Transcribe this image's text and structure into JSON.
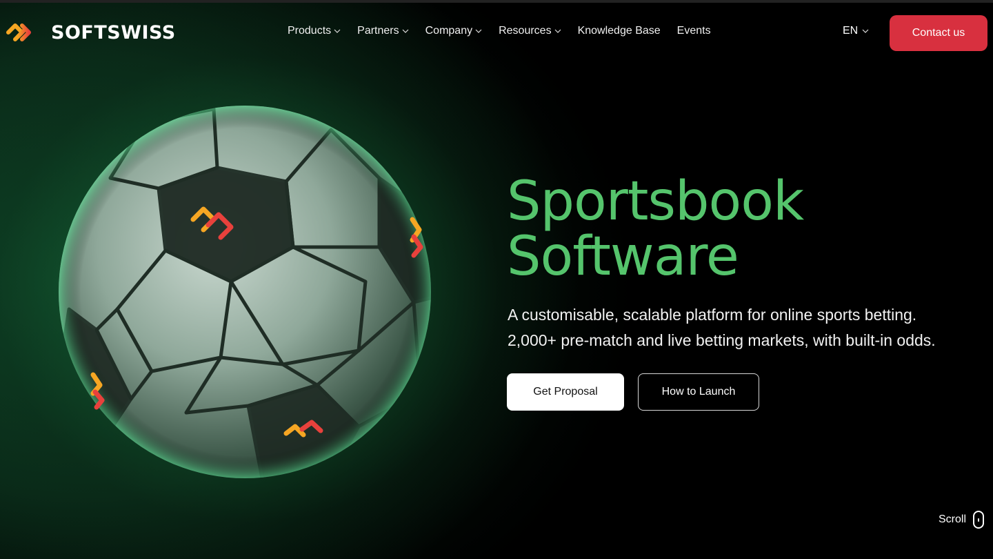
{
  "header": {
    "logo_text": "SOFTSWISS",
    "nav": [
      {
        "label": "Products",
        "dropdown": true
      },
      {
        "label": "Partners",
        "dropdown": true
      },
      {
        "label": "Company",
        "dropdown": true
      },
      {
        "label": "Resources",
        "dropdown": true
      },
      {
        "label": "Knowledge Base",
        "dropdown": false
      },
      {
        "label": "Events",
        "dropdown": false
      }
    ],
    "language": "EN",
    "contact_label": "Contact us"
  },
  "hero": {
    "title_line1": "Sportsbook",
    "title_line2": "Software",
    "description_line1": "A customisable, scalable platform for online sports betting.",
    "description_line2": "2,000+ pre-match and live betting markets, with built-in odds.",
    "primary_button": "Get Proposal",
    "secondary_button": "How to Launch"
  },
  "scroll_label": "Scroll",
  "colors": {
    "accent_green": "#55c46c",
    "contact_red": "#d8303f",
    "logo_orange": "#f6a623",
    "logo_red": "#e8413c"
  }
}
